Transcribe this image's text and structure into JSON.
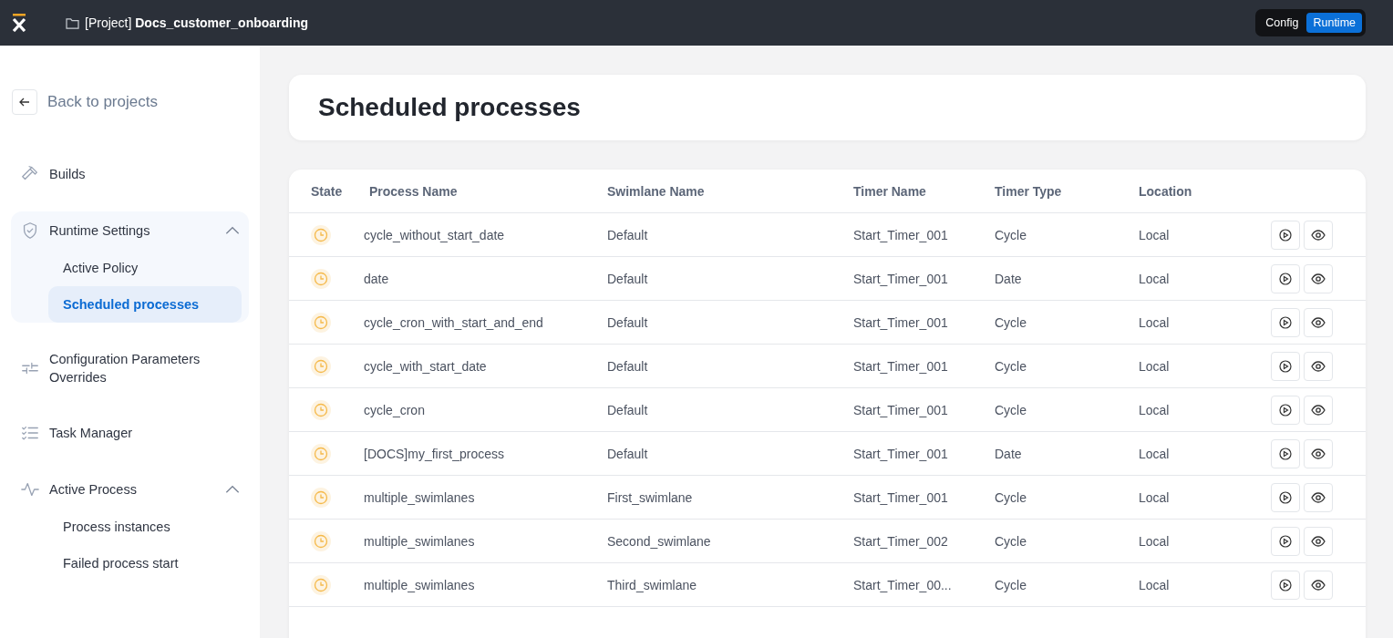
{
  "header": {
    "project_prefix": "[Project]",
    "project_name": "Docs_customer_onboarding",
    "mode_toggle": [
      {
        "label": "Config",
        "selected": false
      },
      {
        "label": "Runtime",
        "selected": true
      }
    ]
  },
  "sidebar": {
    "back_label": "Back to projects",
    "items": [
      {
        "label": "Builds"
      },
      {
        "label": "Runtime Settings",
        "expanded": true,
        "children": [
          {
            "label": "Active Policy",
            "selected": false
          },
          {
            "label": "Scheduled processes",
            "selected": true
          }
        ]
      },
      {
        "label": "Configuration Parameters Overrides"
      },
      {
        "label": "Task Manager"
      },
      {
        "label": "Active Process",
        "expanded": true,
        "children": [
          {
            "label": "Process instances",
            "selected": false
          },
          {
            "label": "Failed process start",
            "selected": false
          }
        ]
      }
    ]
  },
  "page_title": "Scheduled processes",
  "table": {
    "columns": [
      "State",
      "Process Name",
      "Swimlane Name",
      "Timer Name",
      "Timer Type",
      "Location"
    ],
    "rows": [
      {
        "process": "cycle_without_start_date",
        "swimlane": "Default",
        "timer": "Start_Timer_001",
        "type": "Cycle",
        "location": "Local"
      },
      {
        "process": "date",
        "swimlane": "Default",
        "timer": "Start_Timer_001",
        "type": "Date",
        "location": "Local"
      },
      {
        "process": "cycle_cron_with_start_and_end",
        "swimlane": "Default",
        "timer": "Start_Timer_001",
        "type": "Cycle",
        "location": "Local"
      },
      {
        "process": "cycle_with_start_date",
        "swimlane": "Default",
        "timer": "Start_Timer_001",
        "type": "Cycle",
        "location": "Local"
      },
      {
        "process": "cycle_cron",
        "swimlane": "Default",
        "timer": "Start_Timer_001",
        "type": "Cycle",
        "location": "Local"
      },
      {
        "process": "[DOCS]my_first_process",
        "swimlane": "Default",
        "timer": "Start_Timer_001",
        "type": "Date",
        "location": "Local"
      },
      {
        "process": "multiple_swimlanes",
        "swimlane": "First_swimlane",
        "timer": "Start_Timer_001",
        "type": "Cycle",
        "location": "Local"
      },
      {
        "process": "multiple_swimlanes",
        "swimlane": "Second_swimlane",
        "timer": "Start_Timer_002",
        "type": "Cycle",
        "location": "Local"
      },
      {
        "process": "multiple_swimlanes",
        "swimlane": "Third_swimlane",
        "timer": "Start_Timer_00...",
        "type": "Cycle",
        "location": "Local"
      }
    ]
  }
}
